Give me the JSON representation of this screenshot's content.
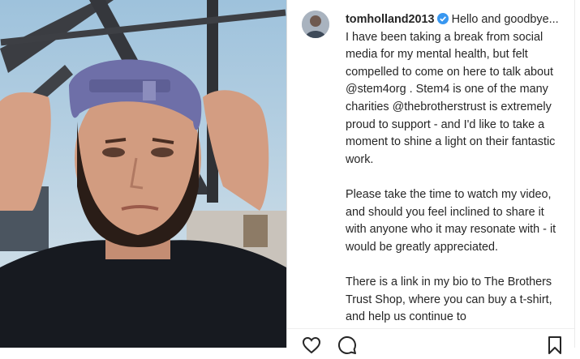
{
  "post": {
    "username": "tomholland2013",
    "caption_p1": "Hello and goodbye... I have been taking a break from social media for my mental health, but felt compelled to come on here to talk about",
    "mention_stem": "@stem4org",
    "caption_p1b": ". Stem4 is one of the many charities",
    "mention_trust": "@thebrotherstrust",
    "caption_p1c": "is extremely proud to support - and I'd like to take a moment to shine a light on their fantastic work.",
    "caption_p2": "Please take the time to watch my video, and should you feel inclined to share it with anyone who it may resonate with - it would be greatly appreciated.",
    "caption_p3": "There is a link in my bio to The Brothers Trust Shop, where you can buy a t-shirt, and help us continue to"
  },
  "icons": {
    "verified": "verified-badge-icon",
    "like": "heart-icon",
    "comment": "comment-icon",
    "save": "bookmark-icon"
  },
  "colors": {
    "verified": "#3897f0",
    "mention": "#00376b",
    "text": "#262626"
  }
}
